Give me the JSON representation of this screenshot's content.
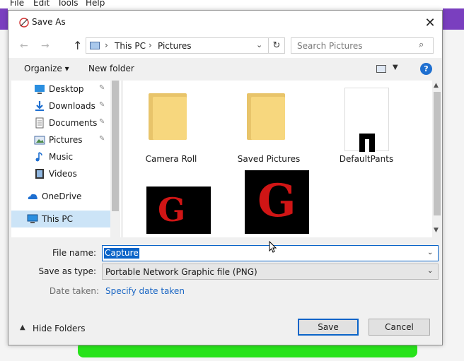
{
  "background_app": {
    "menu": [
      "File",
      "Edit",
      "Tools",
      "Help"
    ]
  },
  "dialog": {
    "title": "Save As",
    "close_glyph": "✕",
    "address": {
      "segments": [
        "This PC",
        "Pictures"
      ],
      "separator": "›"
    },
    "search_placeholder": "Search Pictures",
    "toolbar": {
      "organize": "Organize ▾",
      "new_folder": "New folder",
      "help": "?"
    },
    "nav_items": [
      {
        "label": "Desktop",
        "icon": "desktop-icon",
        "pinned": true
      },
      {
        "label": "Downloads",
        "icon": "download-icon",
        "pinned": true
      },
      {
        "label": "Documents",
        "icon": "documents-icon",
        "pinned": true
      },
      {
        "label": "Pictures",
        "icon": "pictures-icon",
        "pinned": true
      },
      {
        "label": "Music",
        "icon": "music-icon",
        "pinned": false
      },
      {
        "label": "Videos",
        "icon": "videos-icon",
        "pinned": false
      },
      {
        "label": "OneDrive",
        "icon": "onedrive-icon",
        "pinned": false
      },
      {
        "label": "This PC",
        "icon": "this-pc-icon",
        "pinned": false,
        "selected": true
      }
    ],
    "files": [
      {
        "label": "Camera Roll",
        "kind": "folder"
      },
      {
        "label": "Saved Pictures",
        "kind": "folder"
      },
      {
        "label": "DefaultPants",
        "kind": "image"
      },
      {
        "label": "",
        "kind": "image-g"
      },
      {
        "label": "",
        "kind": "image-g"
      }
    ],
    "file_name_label": "File name:",
    "file_name_value": "Capture",
    "save_as_type_label": "Save as type:",
    "save_as_type_value": "Portable Network Graphic file (PNG)",
    "date_taken_label": "Date taken:",
    "date_taken_link": "Specify date taken",
    "hide_folders": "Hide Folders",
    "save_button": "Save",
    "cancel_button": "Cancel"
  },
  "colors": {
    "accent": "#0a64c8",
    "folder": "#f7d77e",
    "selected_nav": "#cce4f7",
    "background_purple": "#7a3fbf",
    "background_green": "#27e31a"
  }
}
